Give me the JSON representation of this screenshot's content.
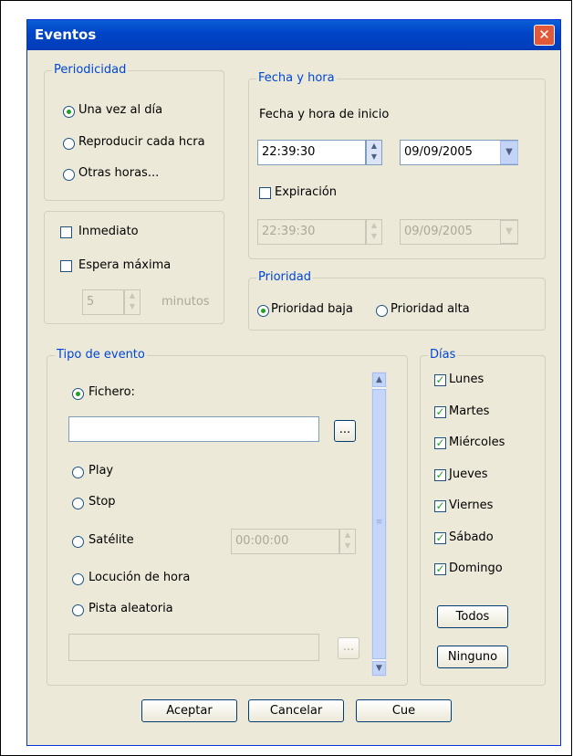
{
  "window": {
    "title": "Eventos"
  },
  "periodicidad": {
    "legend": "Periodicidad",
    "options": [
      "Una vez al día",
      "Reproducir cada hcra",
      "Otras horas..."
    ],
    "selected": 0
  },
  "espera": {
    "inmediato": "Inmediato",
    "espera_maxima": "Espera máxima",
    "minutes_value": "5",
    "minutes_unit": "minutos"
  },
  "fecha_hora": {
    "legend": "Fecha y hora",
    "inicio_label": "Fecha y hora de inicio",
    "inicio_time": "22:39:30",
    "inicio_date": "09/09/2005",
    "expiracion_label": "Expiración",
    "exp_time": "22:39:30",
    "exp_date": "09/09/2005"
  },
  "prioridad": {
    "legend": "Prioridad",
    "baja": "Prioridad baja",
    "alta": "Prioridad alta",
    "selected": "baja"
  },
  "tipo_evento": {
    "legend": "Tipo de evento",
    "fichero": "Fichero:",
    "fichero_value": "",
    "browse": "...",
    "play": "Play",
    "stop": "Stop",
    "satelite": "Satélite",
    "satelite_time": "00:00:00",
    "locucion": "Locución de hora",
    "pista": "Pista aleatoria",
    "pista_value": "",
    "browse2": "...",
    "selected": "fichero"
  },
  "dias": {
    "legend": "Días",
    "items": [
      "Lunes",
      "Martes",
      "Miércoles",
      "Jueves",
      "Viernes",
      "Sábado",
      "Domingo"
    ],
    "checked": [
      true,
      true,
      true,
      true,
      true,
      true,
      true
    ],
    "todos": "Todos",
    "ninguno": "Ninguno"
  },
  "buttons": {
    "aceptar": "Aceptar",
    "cancelar": "Cancelar",
    "cue": "Cue"
  },
  "colors": {
    "title_bar": "#0046c8",
    "legend": "#0046d5",
    "dialog_bg": "#ece9d8",
    "check": "#21a121",
    "close": "#e05a3a"
  },
  "icons": {
    "close": "close-icon",
    "spin": "spin-arrows-icon",
    "dropdown": "chevron-down-icon",
    "check": "checkmark-icon"
  }
}
